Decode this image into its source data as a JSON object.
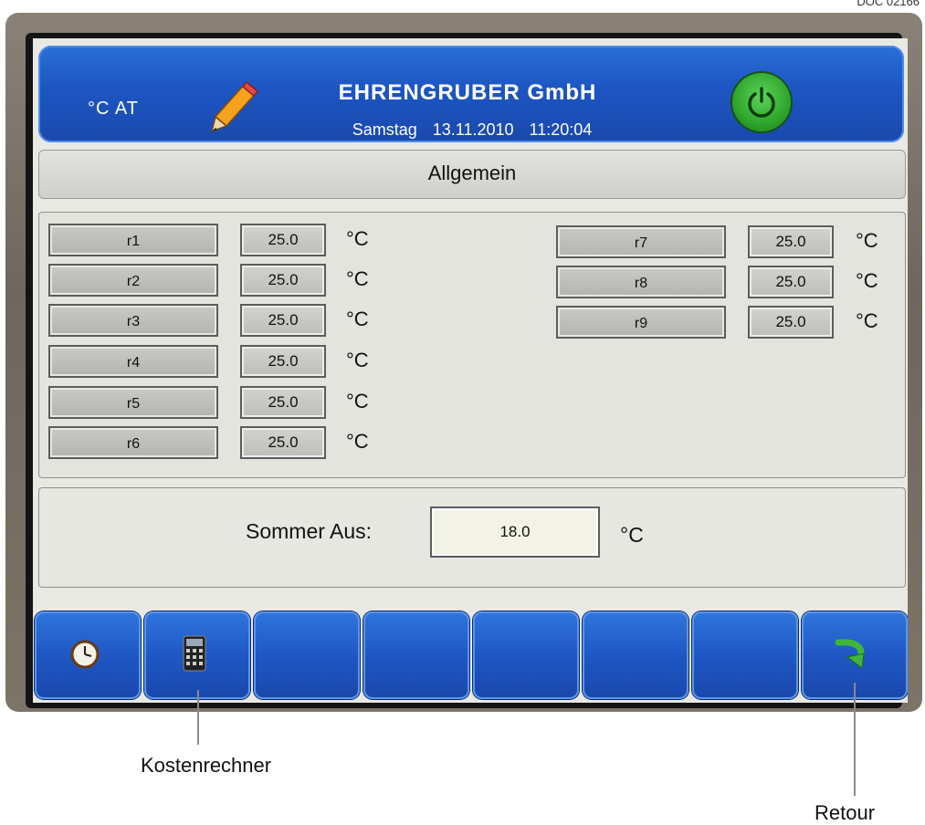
{
  "doc_id": "DOC 02166",
  "header": {
    "unit_indicator": "°C AT",
    "company": "EHRENGRUBER GmbH",
    "day": "Samstag",
    "date": "13.11.2010",
    "time": "11:20:04",
    "icons": {
      "edit": "pencil-icon",
      "power": "power-icon"
    }
  },
  "section": {
    "title": "Allgemein"
  },
  "params_left": [
    {
      "label": "r1",
      "value": "25.0",
      "unit": "°C"
    },
    {
      "label": "r2",
      "value": "25.0",
      "unit": "°C"
    },
    {
      "label": "r3",
      "value": "25.0",
      "unit": "°C"
    },
    {
      "label": "r4",
      "value": "25.0",
      "unit": "°C"
    },
    {
      "label": "r5",
      "value": "25.0",
      "unit": "°C"
    },
    {
      "label": "r6",
      "value": "25.0",
      "unit": "°C"
    }
  ],
  "params_right": [
    {
      "label": "r7",
      "value": "25.0",
      "unit": "°C"
    },
    {
      "label": "r8",
      "value": "25.0",
      "unit": "°C"
    },
    {
      "label": "r9",
      "value": "25.0",
      "unit": "°C"
    }
  ],
  "summer": {
    "label": "Sommer Aus:",
    "value": "18.0",
    "unit": "°C"
  },
  "softkeys": [
    {
      "icon": "clock-icon"
    },
    {
      "icon": "calculator-icon"
    },
    {
      "icon": ""
    },
    {
      "icon": ""
    },
    {
      "icon": ""
    },
    {
      "icon": ""
    },
    {
      "icon": ""
    },
    {
      "icon": "return-arrow-icon"
    }
  ],
  "callouts": {
    "kostenrechner": "Kostenrechner",
    "retour": "Retour"
  },
  "colors": {
    "header_blue": "#1d55c2",
    "power_green": "#2ea52b",
    "return_green": "#3fb63a"
  }
}
